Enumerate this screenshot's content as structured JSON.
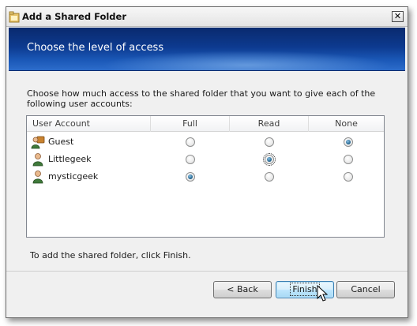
{
  "window": {
    "title": "Add a Shared Folder",
    "close_label": "✕"
  },
  "banner": {
    "title": "Choose the level of access"
  },
  "instruction": "Choose how much access to the shared folder that you want to give each of the following user accounts:",
  "table": {
    "headers": [
      "User Account",
      "Full",
      "Read",
      "None"
    ],
    "rows": [
      {
        "name": "Guest",
        "icon": "guest-user-icon",
        "selected": "None"
      },
      {
        "name": "Littlegeek",
        "icon": "user-icon",
        "selected": "Read"
      },
      {
        "name": "mysticgeek",
        "icon": "user-icon",
        "selected": "Full"
      }
    ]
  },
  "footer_text": "To add the shared folder, click Finish.",
  "buttons": {
    "back": "< Back",
    "finish": "Finish",
    "cancel": "Cancel"
  },
  "colors": {
    "banner_dark": "#0a2a6e",
    "banner_light": "#2c6ccb",
    "finish_border": "#3c7fb1"
  }
}
